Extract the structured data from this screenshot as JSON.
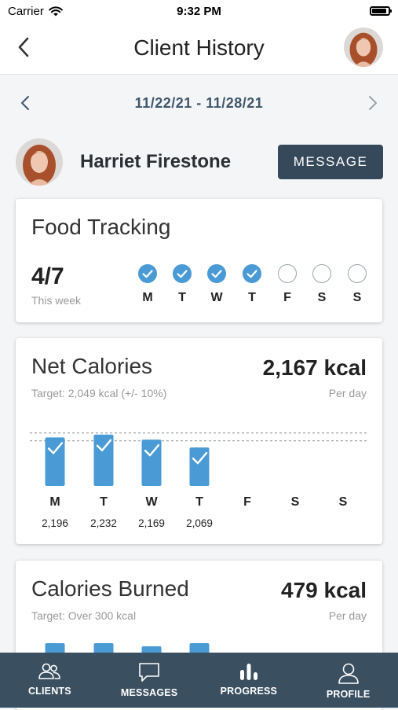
{
  "status": {
    "carrier": "Carrier",
    "time": "9:32 PM",
    "battery_level": 0.9
  },
  "nav": {
    "title": "Client History"
  },
  "date": {
    "range": "11/22/21 - 11/28/21"
  },
  "client": {
    "name": "Harriet Firestone",
    "message_label": "MESSAGE"
  },
  "food_tracking": {
    "title": "Food Tracking",
    "value": "4/7",
    "subtitle": "This week",
    "days": [
      {
        "label": "M",
        "done": true
      },
      {
        "label": "T",
        "done": true
      },
      {
        "label": "W",
        "done": true
      },
      {
        "label": "T",
        "done": true
      },
      {
        "label": "F",
        "done": false
      },
      {
        "label": "S",
        "done": false
      },
      {
        "label": "S",
        "done": false
      }
    ]
  },
  "net_calories": {
    "title": "Net Calories",
    "value": "2,167 kcal",
    "per": "Per day",
    "target": "Target: 2,049 kcal (+/- 10%)"
  },
  "calories_burned": {
    "title": "Calories Burned",
    "value": "479 kcal",
    "per": "Per day",
    "target": "Target: Over 300 kcal"
  },
  "chart_data": [
    {
      "type": "bar",
      "title": "Net Calories",
      "categories": [
        "M",
        "T",
        "W",
        "T",
        "F",
        "S",
        "S"
      ],
      "values": [
        2196,
        2232,
        2169,
        2069,
        null,
        null,
        null
      ],
      "value_labels": [
        "2,196",
        "2,232",
        "2,169",
        "2,069",
        "",
        "",
        ""
      ],
      "target": 2049,
      "target_band": [
        1844,
        2254
      ],
      "met_target": [
        true,
        true,
        true,
        true,
        false,
        false,
        false
      ]
    },
    {
      "type": "bar",
      "title": "Calories Burned",
      "categories": [
        "M",
        "T",
        "W",
        "T",
        "F",
        "S",
        "S"
      ],
      "values": [
        null,
        null,
        null,
        null,
        null,
        null,
        null
      ],
      "target": 300
    }
  ],
  "tabs": [
    {
      "label": "CLIENTS",
      "icon": "clients-icon"
    },
    {
      "label": "MESSAGES",
      "icon": "messages-icon"
    },
    {
      "label": "PROGRESS",
      "icon": "progress-icon"
    },
    {
      "label": "PROFILE",
      "icon": "profile-icon"
    }
  ],
  "colors": {
    "accent": "#4a9ad5",
    "dark": "#35495a",
    "tabbar": "#3a4f60"
  }
}
